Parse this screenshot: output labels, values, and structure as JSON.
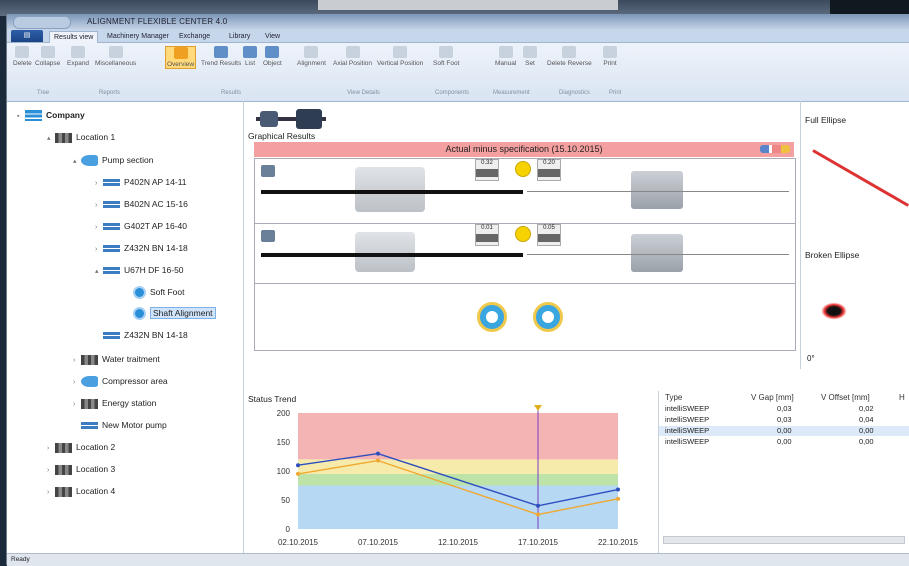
{
  "window": {
    "title": "ALIGNMENT FLEXIBLE CENTER 4.0"
  },
  "tabs": [
    "Results view",
    "Machinery Manager",
    "Exchange",
    "Library",
    "View"
  ],
  "ribbon": {
    "buttons": [
      "Delete",
      "Collapse",
      "Expand",
      "Miscellaneous",
      "Overview",
      "Trend Results",
      "List",
      "Object",
      "Alignment",
      "Axial Position",
      "Vertical Position",
      "Soft Foot",
      "Manual",
      "Set",
      "Delete Reverse",
      "Print"
    ],
    "groups": [
      "Tree",
      "Reports",
      "Results",
      "View Details",
      "Components",
      "Measurement",
      "Diagnostics",
      "Print"
    ]
  },
  "tree": {
    "company": "Company",
    "location1": "Location 1",
    "pump_section": "Pump section",
    "machines": [
      "P402N AP 14-11",
      "B402N AC 15-16",
      "G402T AP 16-40",
      "Z432N BN 14-18",
      "U67H DF 16-50"
    ],
    "soft_foot": "Soft Foot",
    "shaft_alignment": "Shaft Alignment",
    "machine6": "Z432N BN 14-18",
    "water": "Water traitment",
    "compressor": "Compressor area",
    "energy": "Energy station",
    "new_motor": "New Motor pump",
    "location2": "Location 2",
    "location3": "Location 3",
    "location4": "Location 4"
  },
  "graphical": {
    "title": "Graphical Results",
    "banner": "Actual minus specification (15.10.2015)",
    "v1a": "0.32",
    "v1b": "0.20",
    "v2a": "0.01",
    "v2b": "0.05"
  },
  "side": {
    "full_ellipse": "Full Ellipse",
    "broken_ellipse": "Broken Ellipse",
    "angle": "0°"
  },
  "status_trend": {
    "title": "Status Trend"
  },
  "chart_data": {
    "type": "line",
    "x": [
      "02.10.2015",
      "07.10.2015",
      "12.10.2015",
      "17.10.2015",
      "22.10.2015"
    ],
    "x_ticks": [
      "02.10.2015",
      "07.10.2015",
      "12.10.2015",
      "17.10.2015",
      "22.10.2015"
    ],
    "y_ticks": [
      "0",
      "50",
      "100",
      "150",
      "200"
    ],
    "ylim": [
      0,
      200
    ],
    "series": [
      {
        "values": [
          110,
          130,
          null,
          40,
          68
        ],
        "color": "#2e4fbf"
      },
      {
        "values": [
          95,
          118,
          null,
          25,
          52
        ],
        "color": "#f0a830"
      }
    ],
    "series_x_days": [
      0,
      5,
      15,
      20
    ],
    "bands": [
      {
        "from": 0,
        "to": 75,
        "color": "#b7d8f2"
      },
      {
        "from": 75,
        "to": 95,
        "color": "#bde3a8"
      },
      {
        "from": 95,
        "to": 120,
        "color": "#f6ebaa"
      },
      {
        "from": 120,
        "to": 200,
        "color": "#f4b4b4"
      }
    ]
  },
  "table": {
    "headers": [
      "Type",
      "V Gap [mm]",
      "V Offset [mm]",
      "H"
    ],
    "rows": [
      [
        "intelliSWEEP",
        "0,03",
        "0,02"
      ],
      [
        "intelliSWEEP",
        "0,03",
        "0,04"
      ],
      [
        "intelliSWEEP",
        "0,00",
        "0,00"
      ],
      [
        "intelliSWEEP",
        "0,00",
        "0,00"
      ]
    ]
  },
  "status": {
    "left": "Ready"
  }
}
